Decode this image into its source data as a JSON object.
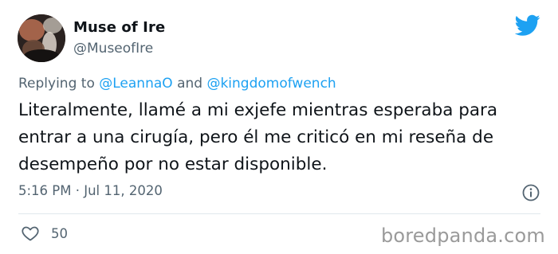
{
  "tweet": {
    "display_name": "Muse of Ire",
    "handle": "@MuseofIre",
    "replying_prefix": "Replying to",
    "replying_user1": "@LeannaO",
    "replying_conjunction": "and",
    "replying_user2": "@kingdomofwench",
    "text": "Literalmente, llamé a mi exjefe mientras esperaba para entrar a una cirugía, pero él me criticó en mi reseña de desempeño por no estar disponible.",
    "time": "5:16 PM",
    "separator": "·",
    "date": "Jul 11, 2020",
    "likes": "50"
  },
  "icons": {
    "brand": "twitter-bird-icon",
    "info": "info-icon",
    "like": "heart-icon"
  },
  "watermark": "boredpanda.com",
  "colors": {
    "accent": "#1da1f2",
    "secondary_text": "#536471",
    "primary_text": "#0f1419",
    "watermark": "#9a9a9a"
  }
}
